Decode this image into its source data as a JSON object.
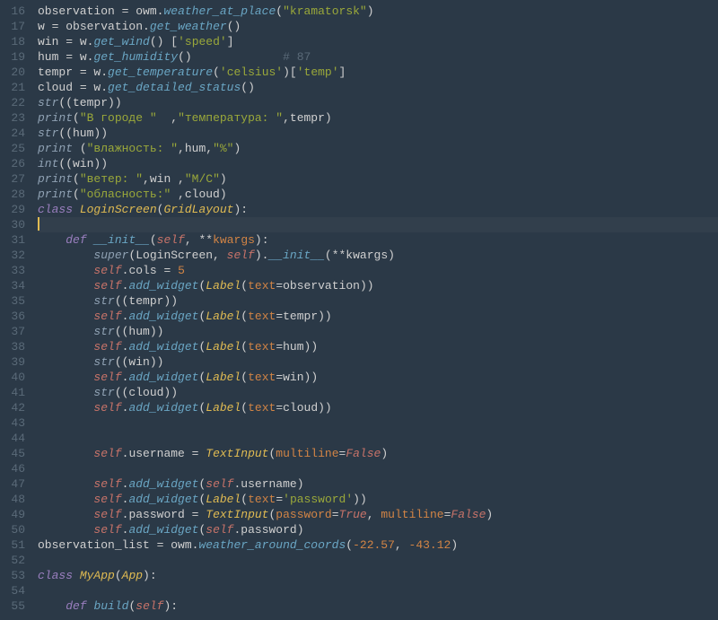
{
  "editor": {
    "first_line_number": 16,
    "current_line_index": 14,
    "lines": [
      [
        [
          "observation ",
          "default"
        ],
        [
          "=",
          "default"
        ],
        [
          " owm",
          "default"
        ],
        [
          ".",
          "default"
        ],
        [
          "weather_at_place",
          "attr"
        ],
        [
          "(",
          "default"
        ],
        [
          "\"kramatorsk\"",
          "string"
        ],
        [
          ")",
          "default"
        ]
      ],
      [
        [
          "w ",
          "default"
        ],
        [
          "=",
          "default"
        ],
        [
          " observation",
          "default"
        ],
        [
          ".",
          "default"
        ],
        [
          "get_weather",
          "attr"
        ],
        [
          "()",
          "default"
        ]
      ],
      [
        [
          "win ",
          "default"
        ],
        [
          "=",
          "default"
        ],
        [
          " w",
          "default"
        ],
        [
          ".",
          "default"
        ],
        [
          "get_wind",
          "attr"
        ],
        [
          "() [",
          "default"
        ],
        [
          "'speed'",
          "string"
        ],
        [
          "]",
          "default"
        ]
      ],
      [
        [
          "hum ",
          "default"
        ],
        [
          "=",
          "default"
        ],
        [
          " w",
          "default"
        ],
        [
          ".",
          "default"
        ],
        [
          "get_humidity",
          "attr"
        ],
        [
          "()             ",
          "default"
        ],
        [
          "# 87",
          "comment"
        ]
      ],
      [
        [
          "tempr ",
          "default"
        ],
        [
          "=",
          "default"
        ],
        [
          " w",
          "default"
        ],
        [
          ".",
          "default"
        ],
        [
          "get_temperature",
          "attr"
        ],
        [
          "(",
          "default"
        ],
        [
          "'celsius'",
          "string"
        ],
        [
          ")[",
          "default"
        ],
        [
          "'temp'",
          "string"
        ],
        [
          "]",
          "default"
        ]
      ],
      [
        [
          "cloud ",
          "default"
        ],
        [
          "=",
          "default"
        ],
        [
          " w",
          "default"
        ],
        [
          ".",
          "default"
        ],
        [
          "get_detailed_status",
          "attr"
        ],
        [
          "()",
          "default"
        ]
      ],
      [
        [
          "str",
          "builtin"
        ],
        [
          "((tempr))",
          "default"
        ]
      ],
      [
        [
          "print",
          "builtin"
        ],
        [
          "(",
          "default"
        ],
        [
          "\"В городе \"  ",
          "string"
        ],
        [
          ",",
          "default"
        ],
        [
          "\"температура: \"",
          "string"
        ],
        [
          ",tempr)",
          "default"
        ]
      ],
      [
        [
          "str",
          "builtin"
        ],
        [
          "((hum))",
          "default"
        ]
      ],
      [
        [
          "print",
          "builtin"
        ],
        [
          " (",
          "default"
        ],
        [
          "\"влажность: \"",
          "string"
        ],
        [
          ",hum,",
          "default"
        ],
        [
          "\"%\"",
          "string"
        ],
        [
          ")",
          "default"
        ]
      ],
      [
        [
          "int",
          "builtin"
        ],
        [
          "((win))",
          "default"
        ]
      ],
      [
        [
          "print",
          "builtin"
        ],
        [
          "(",
          "default"
        ],
        [
          "\"ветер: \"",
          "string"
        ],
        [
          ",win ,",
          "default"
        ],
        [
          "\"M/C\"",
          "string"
        ],
        [
          ")",
          "default"
        ]
      ],
      [
        [
          "print",
          "builtin"
        ],
        [
          "(",
          "default"
        ],
        [
          "\"обласность:\"",
          "string"
        ],
        [
          " ,cloud)",
          "default"
        ]
      ],
      [
        [
          "class ",
          "keyword"
        ],
        [
          "LoginScreen",
          "type"
        ],
        [
          "(",
          "default"
        ],
        [
          "GridLayout",
          "type"
        ],
        [
          "):",
          "default"
        ]
      ],
      [],
      [
        [
          "    ",
          "default"
        ],
        [
          "def ",
          "def"
        ],
        [
          "__init__",
          "attr"
        ],
        [
          "(",
          "default"
        ],
        [
          "self",
          "self"
        ],
        [
          ", **",
          "default"
        ],
        [
          "kwargs",
          "param"
        ],
        [
          "):",
          "default"
        ]
      ],
      [
        [
          "        ",
          "default"
        ],
        [
          "super",
          "builtin"
        ],
        [
          "(LoginScreen, ",
          "default"
        ],
        [
          "self",
          "self"
        ],
        [
          ").",
          "default"
        ],
        [
          "__init__",
          "attr"
        ],
        [
          "(**kwargs)",
          "default"
        ]
      ],
      [
        [
          "        ",
          "default"
        ],
        [
          "self",
          "self"
        ],
        [
          ".cols = ",
          "default"
        ],
        [
          "5",
          "number"
        ]
      ],
      [
        [
          "        ",
          "default"
        ],
        [
          "self",
          "self"
        ],
        [
          ".",
          "default"
        ],
        [
          "add_widget",
          "attr"
        ],
        [
          "(",
          "default"
        ],
        [
          "Label",
          "type"
        ],
        [
          "(",
          "default"
        ],
        [
          "text",
          "param"
        ],
        [
          "=observation))",
          "default"
        ]
      ],
      [
        [
          "        ",
          "default"
        ],
        [
          "str",
          "builtin"
        ],
        [
          "((tempr))",
          "default"
        ]
      ],
      [
        [
          "        ",
          "default"
        ],
        [
          "self",
          "self"
        ],
        [
          ".",
          "default"
        ],
        [
          "add_widget",
          "attr"
        ],
        [
          "(",
          "default"
        ],
        [
          "Label",
          "type"
        ],
        [
          "(",
          "default"
        ],
        [
          "text",
          "param"
        ],
        [
          "=tempr))",
          "default"
        ]
      ],
      [
        [
          "        ",
          "default"
        ],
        [
          "str",
          "builtin"
        ],
        [
          "((hum))",
          "default"
        ]
      ],
      [
        [
          "        ",
          "default"
        ],
        [
          "self",
          "self"
        ],
        [
          ".",
          "default"
        ],
        [
          "add_widget",
          "attr"
        ],
        [
          "(",
          "default"
        ],
        [
          "Label",
          "type"
        ],
        [
          "(",
          "default"
        ],
        [
          "text",
          "param"
        ],
        [
          "=hum))",
          "default"
        ]
      ],
      [
        [
          "        ",
          "default"
        ],
        [
          "str",
          "builtin"
        ],
        [
          "((win))",
          "default"
        ]
      ],
      [
        [
          "        ",
          "default"
        ],
        [
          "self",
          "self"
        ],
        [
          ".",
          "default"
        ],
        [
          "add_widget",
          "attr"
        ],
        [
          "(",
          "default"
        ],
        [
          "Label",
          "type"
        ],
        [
          "(",
          "default"
        ],
        [
          "text",
          "param"
        ],
        [
          "=win))",
          "default"
        ]
      ],
      [
        [
          "        ",
          "default"
        ],
        [
          "str",
          "builtin"
        ],
        [
          "((cloud))",
          "default"
        ]
      ],
      [
        [
          "        ",
          "default"
        ],
        [
          "self",
          "self"
        ],
        [
          ".",
          "default"
        ],
        [
          "add_widget",
          "attr"
        ],
        [
          "(",
          "default"
        ],
        [
          "Label",
          "type"
        ],
        [
          "(",
          "default"
        ],
        [
          "text",
          "param"
        ],
        [
          "=cloud))",
          "default"
        ]
      ],
      [],
      [],
      [
        [
          "        ",
          "default"
        ],
        [
          "self",
          "self"
        ],
        [
          ".username = ",
          "default"
        ],
        [
          "TextInput",
          "type"
        ],
        [
          "(",
          "default"
        ],
        [
          "multiline",
          "param"
        ],
        [
          "=",
          "default"
        ],
        [
          "False",
          "const"
        ],
        [
          ")",
          "default"
        ]
      ],
      [],
      [
        [
          "        ",
          "default"
        ],
        [
          "self",
          "self"
        ],
        [
          ".",
          "default"
        ],
        [
          "add_widget",
          "attr"
        ],
        [
          "(",
          "default"
        ],
        [
          "self",
          "self"
        ],
        [
          ".username)",
          "default"
        ]
      ],
      [
        [
          "        ",
          "default"
        ],
        [
          "self",
          "self"
        ],
        [
          ".",
          "default"
        ],
        [
          "add_widget",
          "attr"
        ],
        [
          "(",
          "default"
        ],
        [
          "Label",
          "type"
        ],
        [
          "(",
          "default"
        ],
        [
          "text",
          "param"
        ],
        [
          "=",
          "default"
        ],
        [
          "'password'",
          "string"
        ],
        [
          "))",
          "default"
        ]
      ],
      [
        [
          "        ",
          "default"
        ],
        [
          "self",
          "self"
        ],
        [
          ".password = ",
          "default"
        ],
        [
          "TextInput",
          "type"
        ],
        [
          "(",
          "default"
        ],
        [
          "password",
          "param"
        ],
        [
          "=",
          "default"
        ],
        [
          "True",
          "const"
        ],
        [
          ", ",
          "default"
        ],
        [
          "multiline",
          "param"
        ],
        [
          "=",
          "default"
        ],
        [
          "False",
          "const"
        ],
        [
          ")",
          "default"
        ]
      ],
      [
        [
          "        ",
          "default"
        ],
        [
          "self",
          "self"
        ],
        [
          ".",
          "default"
        ],
        [
          "add_widget",
          "attr"
        ],
        [
          "(",
          "default"
        ],
        [
          "self",
          "self"
        ],
        [
          ".password)",
          "default"
        ]
      ],
      [
        [
          "observation_list = owm",
          "default"
        ],
        [
          ".",
          "default"
        ],
        [
          "weather_around_coords",
          "attr"
        ],
        [
          "(",
          "default"
        ],
        [
          "-22.57",
          "number"
        ],
        [
          ", ",
          "default"
        ],
        [
          "-43.12",
          "number"
        ],
        [
          ")",
          "default"
        ]
      ],
      [],
      [
        [
          "class ",
          "keyword"
        ],
        [
          "MyApp",
          "type"
        ],
        [
          "(",
          "default"
        ],
        [
          "App",
          "type"
        ],
        [
          "):",
          "default"
        ]
      ],
      [],
      [
        [
          "    ",
          "default"
        ],
        [
          "def ",
          "def"
        ],
        [
          "build",
          "attr"
        ],
        [
          "(",
          "default"
        ],
        [
          "self",
          "self"
        ],
        [
          "):",
          "default"
        ]
      ]
    ]
  }
}
